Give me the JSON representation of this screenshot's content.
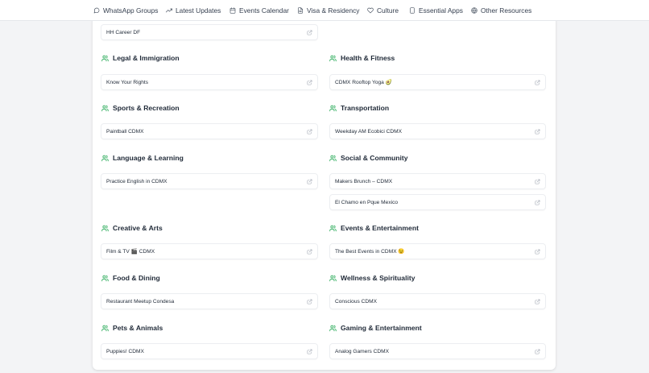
{
  "nav": [
    {
      "label": "WhatsApp Groups",
      "icon": "message-circle-icon"
    },
    {
      "label": "Latest Updates",
      "icon": "trending-up-icon"
    },
    {
      "label": "Events Calendar",
      "icon": "calendar-icon"
    },
    {
      "label": "Visa & Residency",
      "icon": "file-text-icon"
    },
    {
      "label": "Culture",
      "icon": "heart-icon"
    },
    {
      "label": "Essential Apps",
      "icon": "smartphone-icon"
    },
    {
      "label": "Other Resources",
      "icon": "globe-icon"
    }
  ],
  "accent_color": "#16a34a",
  "top_link": {
    "label": "HH Career DF",
    "icon": "external-link-icon"
  },
  "categories": [
    {
      "title": "Legal & Immigration",
      "icon": "users-icon",
      "links": [
        "Know Your Rights"
      ]
    },
    {
      "title": "Health & Fitness",
      "icon": "users-icon",
      "links": [
        "CDMX Rooftop Yoga 🥑"
      ]
    },
    {
      "title": "Sports & Recreation",
      "icon": "users-icon",
      "links": [
        "Paintball CDMX"
      ]
    },
    {
      "title": "Transportation",
      "icon": "users-icon",
      "links": [
        "Weekday AM Ecobici CDMX"
      ]
    },
    {
      "title": "Language & Learning",
      "icon": "users-icon",
      "links": [
        "Practice English in CDMX"
      ]
    },
    {
      "title": "Social & Community",
      "icon": "users-icon",
      "links": [
        "Makers Brunch – CDMX",
        "El Chamo en Pque Mexico"
      ]
    },
    {
      "title": "Creative & Arts",
      "icon": "users-icon",
      "links": [
        "Film & TV 🎬 CDMX"
      ]
    },
    {
      "title": "Events & Entertainment",
      "icon": "users-icon",
      "links": [
        "The Best Events in CDMX 😉"
      ]
    },
    {
      "title": "Food & Dining",
      "icon": "users-icon",
      "links": [
        "Restaurant Meetup Condesa"
      ]
    },
    {
      "title": "Wellness & Spirituality",
      "icon": "users-icon",
      "links": [
        "Conscious CDMX"
      ]
    },
    {
      "title": "Pets & Animals",
      "icon": "users-icon",
      "links": [
        "Puppies! CDMX"
      ]
    },
    {
      "title": "Gaming & Entertainment",
      "icon": "users-icon",
      "links": [
        "Analog Gamers CDMX"
      ]
    }
  ]
}
